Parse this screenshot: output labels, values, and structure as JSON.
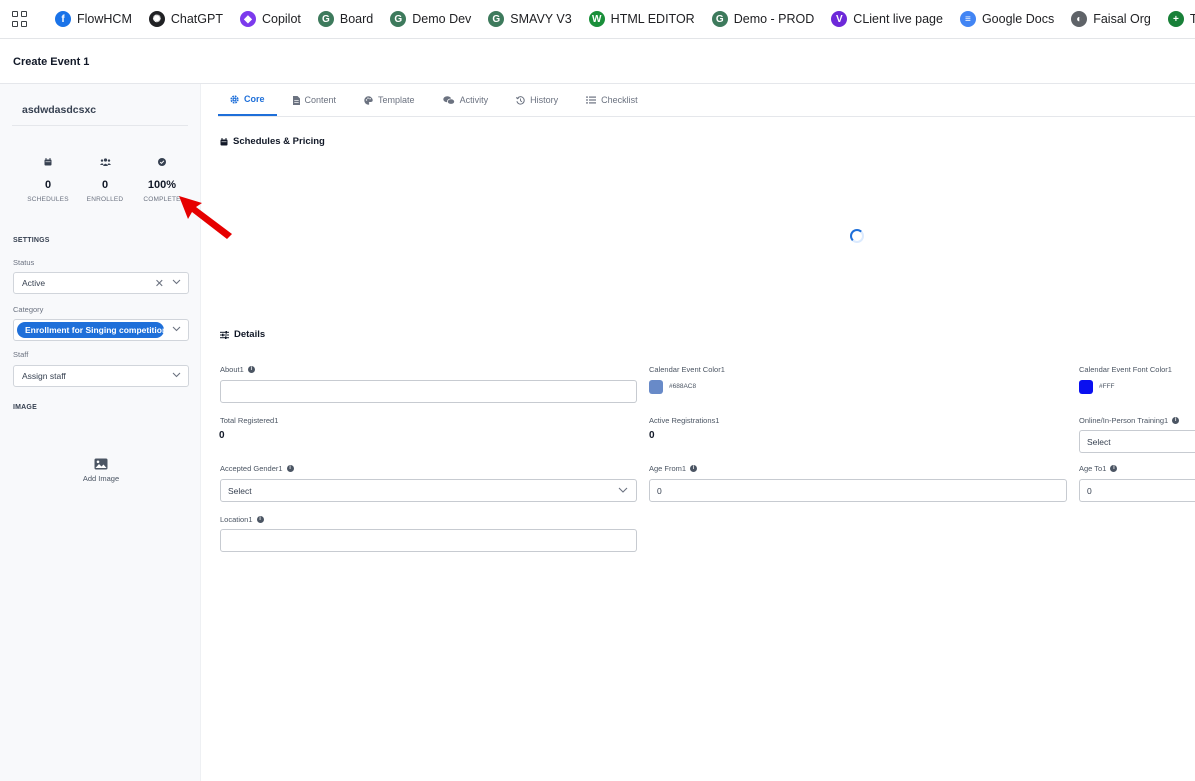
{
  "bookmarks": [
    {
      "label": "FlowHCM",
      "icon": "flowhcm-icon",
      "color": "#1a73e8",
      "glyph": "f"
    },
    {
      "label": "ChatGPT",
      "icon": "chatgpt-icon",
      "color": "#202124",
      "glyph": "✺"
    },
    {
      "label": "Copilot",
      "icon": "copilot-icon",
      "color": "#7c3aed",
      "glyph": "◆"
    },
    {
      "label": "Board",
      "icon": "board-icon",
      "color": "#3d7a5c",
      "glyph": "G"
    },
    {
      "label": "Demo Dev",
      "icon": "demo-dev-icon",
      "color": "#3d7a5c",
      "glyph": "G"
    },
    {
      "label": "SMAVY V3",
      "icon": "smavy-icon",
      "color": "#3d7a5c",
      "glyph": "G"
    },
    {
      "label": "HTML EDITOR",
      "icon": "html-editor-icon",
      "color": "#1a8f3a",
      "glyph": "W"
    },
    {
      "label": "Demo - PROD",
      "icon": "demo-prod-icon",
      "color": "#3d7a5c",
      "glyph": "G"
    },
    {
      "label": "CLient live page",
      "icon": "client-live-icon",
      "color": "#6d28d9",
      "glyph": "V"
    },
    {
      "label": "Google Docs",
      "icon": "google-docs-icon",
      "color": "#4285f4",
      "glyph": "≡"
    },
    {
      "label": "Faisal Org",
      "icon": "faisal-org-icon",
      "color": "#5f6368",
      "glyph": "◐"
    },
    {
      "label": "Test Cases",
      "icon": "test-cases-icon",
      "color": "#188038",
      "glyph": "+"
    }
  ],
  "page": {
    "title": "Create Event 1"
  },
  "sidebar": {
    "event_name": "asdwdasdcsxc",
    "stats": [
      {
        "value": "0",
        "label": "SCHEDULES",
        "icon": "calendar-icon"
      },
      {
        "value": "0",
        "label": "ENROLLED",
        "icon": "users-icon"
      },
      {
        "value": "100%",
        "label": "COMPLETE",
        "icon": "check-circle-icon"
      }
    ],
    "settings_heading": "SETTINGS",
    "status": {
      "label": "Status",
      "value": "Active"
    },
    "category": {
      "label": "Category",
      "value": "Enrollment for Singing competition"
    },
    "staff": {
      "label": "Staff",
      "placeholder": "Assign staff"
    },
    "image_heading": "IMAGE",
    "add_image_label": "Add Image"
  },
  "tabs": [
    {
      "label": "Core",
      "icon": "gear-icon",
      "active": true
    },
    {
      "label": "Content",
      "icon": "document-icon",
      "active": false
    },
    {
      "label": "Template",
      "icon": "palette-icon",
      "active": false
    },
    {
      "label": "Activity",
      "icon": "chat-icon",
      "active": false
    },
    {
      "label": "History",
      "icon": "history-icon",
      "active": false
    },
    {
      "label": "Checklist",
      "icon": "checklist-icon",
      "active": false
    }
  ],
  "schedules": {
    "title": "Schedules & Pricing"
  },
  "details": {
    "title": "Details",
    "about": {
      "label": "About1",
      "value": ""
    },
    "calendar_color": {
      "label": "Calendar Event Color1",
      "value": "#688AC8",
      "swatch": "#688ac8"
    },
    "calendar_font_color": {
      "label": "Calendar Event Font Color1",
      "value": "#FFF",
      "swatch": "#0a10f0"
    },
    "total_registered": {
      "label": "Total Registered1",
      "value": "0"
    },
    "active_registrations": {
      "label": "Active Registrations1",
      "value": "0"
    },
    "training_mode": {
      "label": "Online/In-Person Training1",
      "placeholder": "Select"
    },
    "accepted_gender": {
      "label": "Accepted Gender1",
      "placeholder": "Select"
    },
    "age_from": {
      "label": "Age From1",
      "value": "0"
    },
    "age_to": {
      "label": "Age To1",
      "value": "0"
    },
    "location": {
      "label": "Location1",
      "value": ""
    }
  },
  "theme": {
    "accent": "#1e6fd9",
    "annotation": "#e60000"
  }
}
